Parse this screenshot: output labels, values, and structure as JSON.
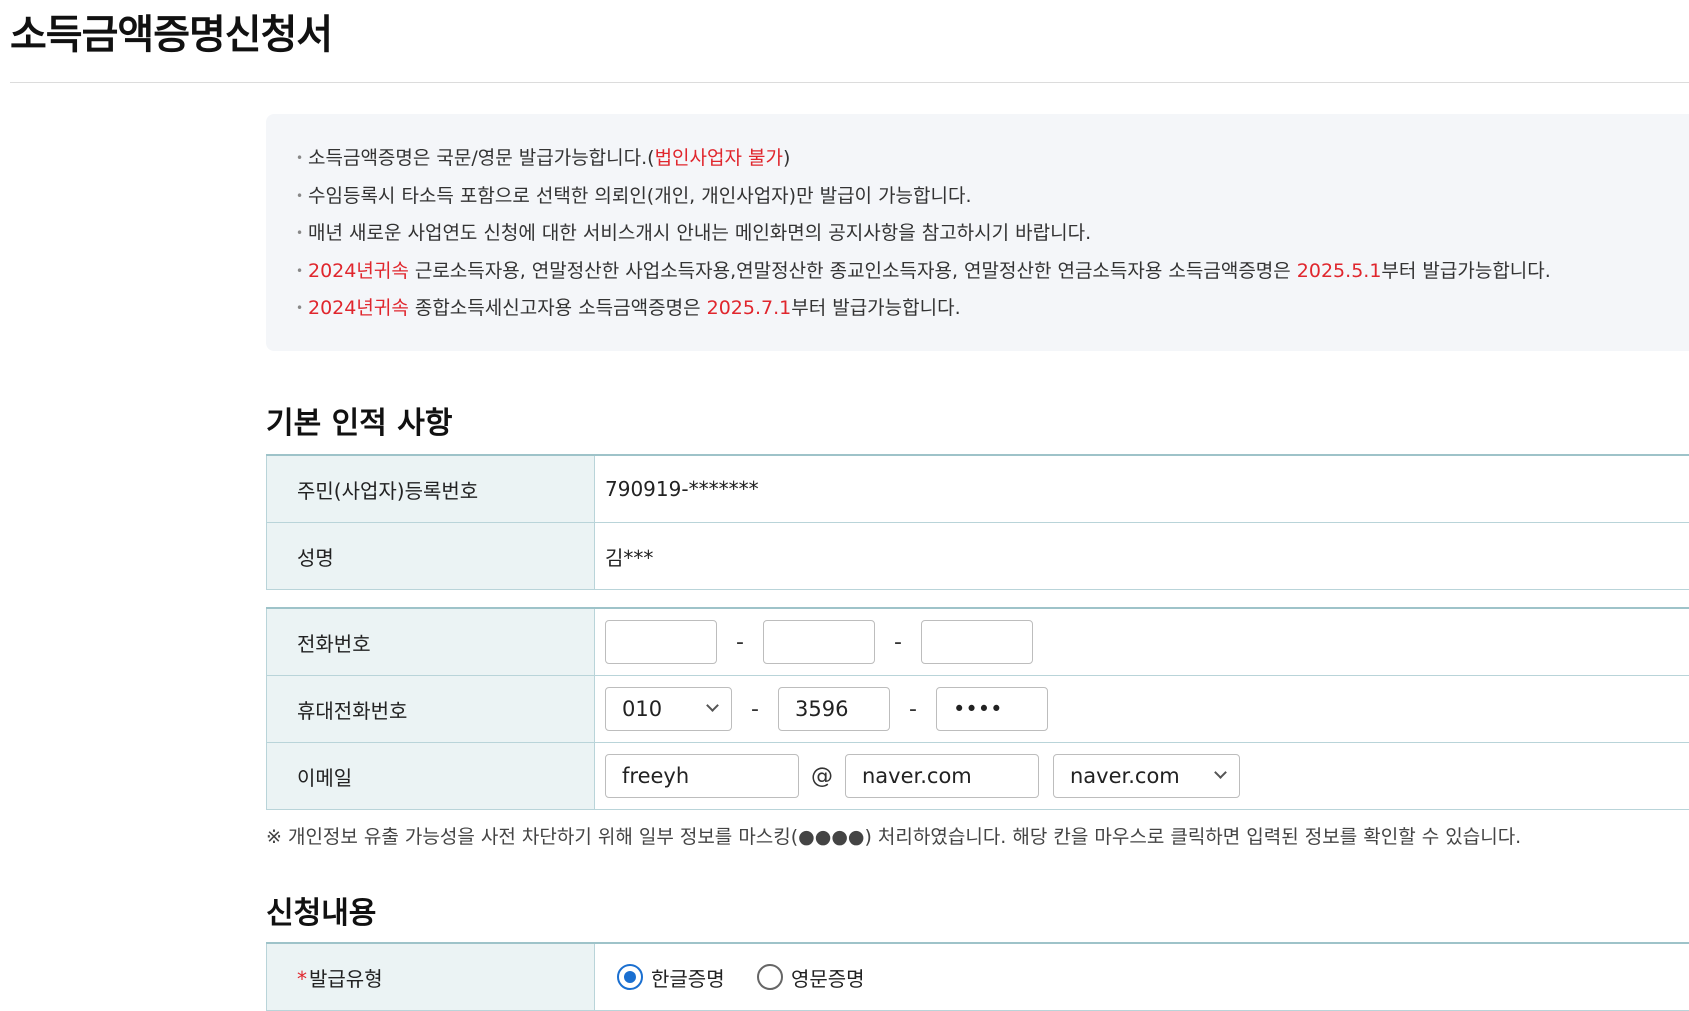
{
  "page": {
    "title": "소득금액증명신청서"
  },
  "notice": {
    "items": [
      {
        "parts": [
          {
            "text": "소득금액증명은 국문/영문 발급가능합니다.(",
            "red": false
          },
          {
            "text": "법인사업자 불가",
            "red": true
          },
          {
            "text": ")",
            "red": false
          }
        ]
      },
      {
        "parts": [
          {
            "text": "수임등록시 타소득 포함으로 선택한 의뢰인(개인, 개인사업자)만 발급이 가능합니다.",
            "red": false
          }
        ]
      },
      {
        "parts": [
          {
            "text": "매년 새로운 사업연도 신청에 대한 서비스개시 안내는 메인화면의 공지사항을 참고하시기 바랍니다.",
            "red": false
          }
        ]
      },
      {
        "parts": [
          {
            "text": "2024년귀속",
            "red": true
          },
          {
            "text": " 근로소득자용, 연말정산한 사업소득자용,연말정산한 종교인소득자용, 연말정산한 연금소득자용 소득금액증명은 ",
            "red": false
          },
          {
            "text": "2025.5.1",
            "red": true
          },
          {
            "text": "부터 발급가능합니다.",
            "red": false
          }
        ]
      },
      {
        "parts": [
          {
            "text": "2024년귀속",
            "red": true
          },
          {
            "text": " 종합소득세신고자용 소득금액증명은 ",
            "red": false
          },
          {
            "text": "2025.7.1",
            "red": true
          },
          {
            "text": "부터 발급가능합니다.",
            "red": false
          }
        ]
      }
    ]
  },
  "basic": {
    "title": "기본 인적 사항",
    "id_label": "주민(사업자)등록번호",
    "id_value": "790919-*******",
    "name_label": "성명",
    "name_value": "김***"
  },
  "contact": {
    "phone_label": "전화번호",
    "phone": [
      "",
      "",
      ""
    ],
    "mobile_label": "휴대전화번호",
    "mobile_prefix": "010",
    "mobile_mid": "3596",
    "mobile_last": "••••",
    "email_label": "이메일",
    "email_user": "freeyh",
    "email_at": "@",
    "email_domain": "naver.com",
    "email_domain_select": "naver.com",
    "dash": "-"
  },
  "privacy_note": "※ 개인정보 유출 가능성을 사전 차단하기 위해 일부 정보를 마스킹(●●●●) 처리하였습니다. 해당 칸을 마우스로 클릭하면 입력된 정보를 확인할 수 있습니다.",
  "request": {
    "title": "신청내용",
    "required_mark": "*",
    "type_label": "발급유형",
    "options": [
      {
        "label": "한글증명",
        "checked": true
      },
      {
        "label": "영문증명",
        "checked": false
      }
    ]
  },
  "colors": {
    "accent_red": "#e0262d",
    "radio_blue": "#1a6fd0",
    "label_bg": "#ebf3f4",
    "notice_bg": "#f4f6f9"
  }
}
